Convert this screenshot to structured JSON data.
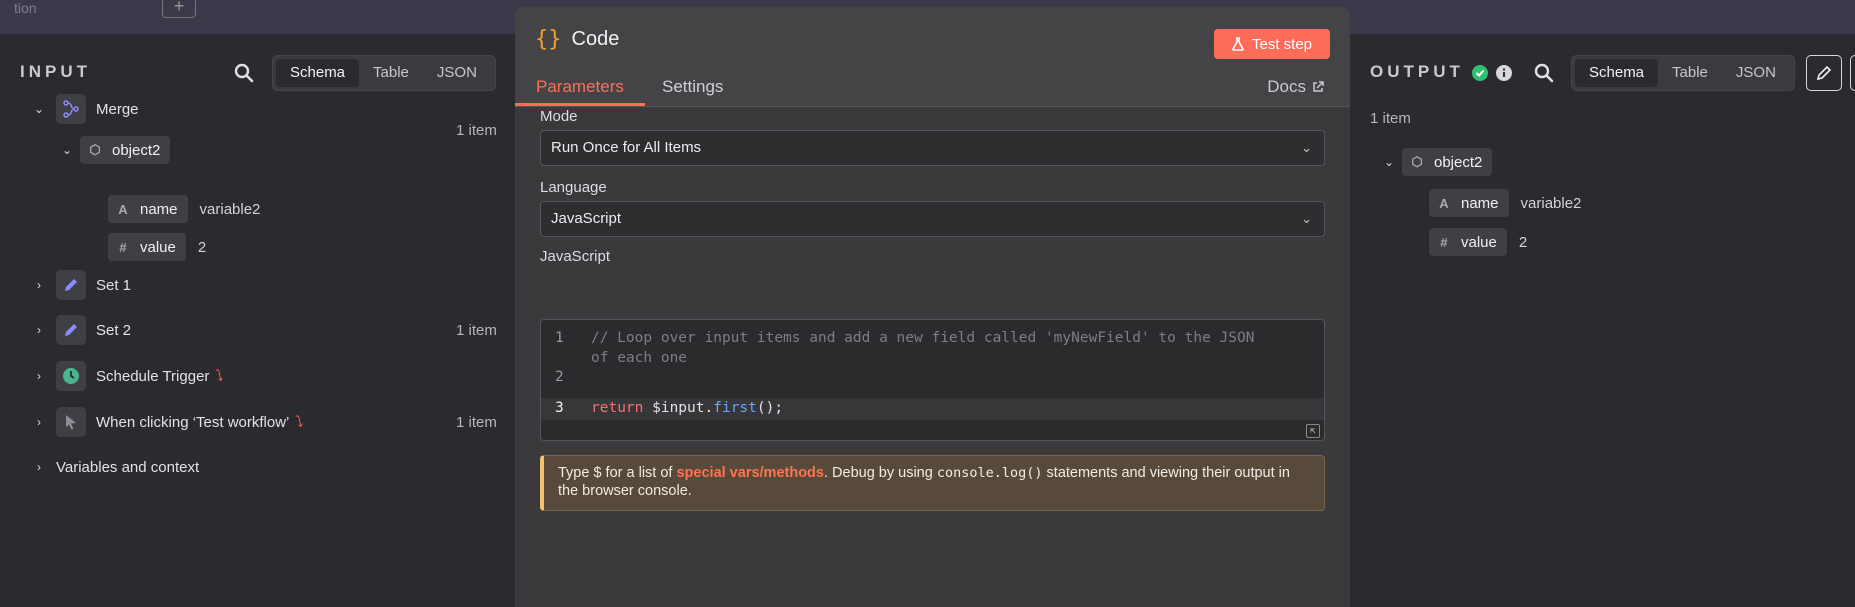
{
  "topbar": {
    "ghost_text": "tion",
    "plus": "+"
  },
  "input": {
    "title": "INPUT",
    "view_tabs": [
      "Schema",
      "Table",
      "JSON"
    ],
    "active_tab": "Schema",
    "nodes": [
      {
        "label": "Merge",
        "count": "1 item"
      },
      {
        "label": "Set 1",
        "count": ""
      },
      {
        "label": "Set 2",
        "count": "1 item"
      },
      {
        "label": "Schedule Trigger",
        "count": ""
      },
      {
        "label": "When clicking ‘Test workflow’",
        "count": "1 item"
      },
      {
        "label": "Variables and context",
        "count": ""
      }
    ],
    "object": {
      "name": "object2",
      "fields": [
        {
          "type": "A",
          "key": "name",
          "value": "variable2"
        },
        {
          "type": "#",
          "key": "value",
          "value": "2"
        }
      ]
    }
  },
  "modal": {
    "title": "Code",
    "test_button": "Test step",
    "tabs": [
      "Parameters",
      "Settings"
    ],
    "active_tab": "Parameters",
    "docs": "Docs",
    "mode_label": "Mode",
    "mode_value": "Run Once for All Items",
    "language_label": "Language",
    "language_value": "JavaScript",
    "editor_label": "JavaScript",
    "code_lines": {
      "l1a": "// Loop over input items and add a new field called 'myNewField' to the JSON",
      "l1b": "of each one",
      "l3_kw": "return",
      "l3_var": " $input.",
      "l3_fn": "first",
      "l3_end": "();"
    },
    "line_numbers": [
      "1",
      "2",
      "3"
    ],
    "notice": {
      "prefix": "Type $ for a list of ",
      "link": "special vars/methods",
      "middle": ". Debug by using ",
      "code": "console.log()",
      "suffix": " statements and viewing their output in the browser console."
    }
  },
  "output": {
    "title": "OUTPUT",
    "view_tabs": [
      "Schema",
      "Table",
      "JSON"
    ],
    "active_tab": "Schema",
    "count": "1 item",
    "object": {
      "name": "object2",
      "fields": [
        {
          "type": "A",
          "key": "name",
          "value": "variable2"
        },
        {
          "type": "#",
          "key": "value",
          "value": "2"
        }
      ]
    }
  },
  "colors": {
    "accent": "#ff6d5a",
    "success": "#2fbf71",
    "icon_blue": "#8c8cff",
    "trigger_green": "#4ab58c",
    "braces": "#f59e2b"
  }
}
